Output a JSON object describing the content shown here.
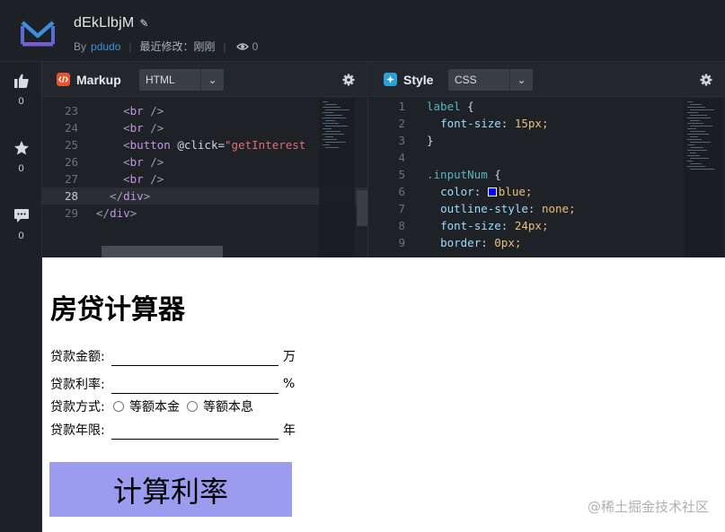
{
  "header": {
    "title": "dEkLlbjM",
    "by_label": "By",
    "author": "pdudo",
    "modified": "最近修改：刚刚",
    "views": "0"
  },
  "sidebar": {
    "likes": "0",
    "stars": "0",
    "comments": "0"
  },
  "markup_panel": {
    "label": "Markup",
    "language": "HTML",
    "icon_color": "#e4572e",
    "lines": [
      {
        "n": "23",
        "code": "    <br />"
      },
      {
        "n": "24",
        "code": "    <br />"
      },
      {
        "n": "25",
        "code": "    <button @click=\"getInterest"
      },
      {
        "n": "26",
        "code": "    <br />"
      },
      {
        "n": "27",
        "code": "    <br />"
      },
      {
        "n": "28",
        "code": "  </div>"
      },
      {
        "n": "29",
        "code": "</div>"
      }
    ]
  },
  "style_panel": {
    "label": "Style",
    "language": "CSS",
    "icon_color": "#2aa2d9",
    "lines": [
      {
        "n": "1",
        "code": "label {"
      },
      {
        "n": "2",
        "code": "  font-size: 15px;"
      },
      {
        "n": "3",
        "code": "}"
      },
      {
        "n": "4",
        "code": ""
      },
      {
        "n": "5",
        "code": ".inputNum {"
      },
      {
        "n": "6",
        "code": "  color: ■blue;"
      },
      {
        "n": "7",
        "code": "  outline-style: none;"
      },
      {
        "n": "8",
        "code": "  font-size: 24px;"
      },
      {
        "n": "9",
        "code": "  border: 0px;"
      }
    ]
  },
  "preview": {
    "title": "房贷计算器",
    "amount_label": "贷款金额:",
    "amount_unit": "万",
    "rate_label": "贷款利率:",
    "rate_unit": "%",
    "method_label": "贷款方式:",
    "method_options": [
      "等额本金",
      "等额本息"
    ],
    "years_label": "贷款年限:",
    "years_unit": "年",
    "button_label": "计算利率",
    "button_color": "#9b9bef"
  },
  "watermark": "@稀土掘金技术社区"
}
